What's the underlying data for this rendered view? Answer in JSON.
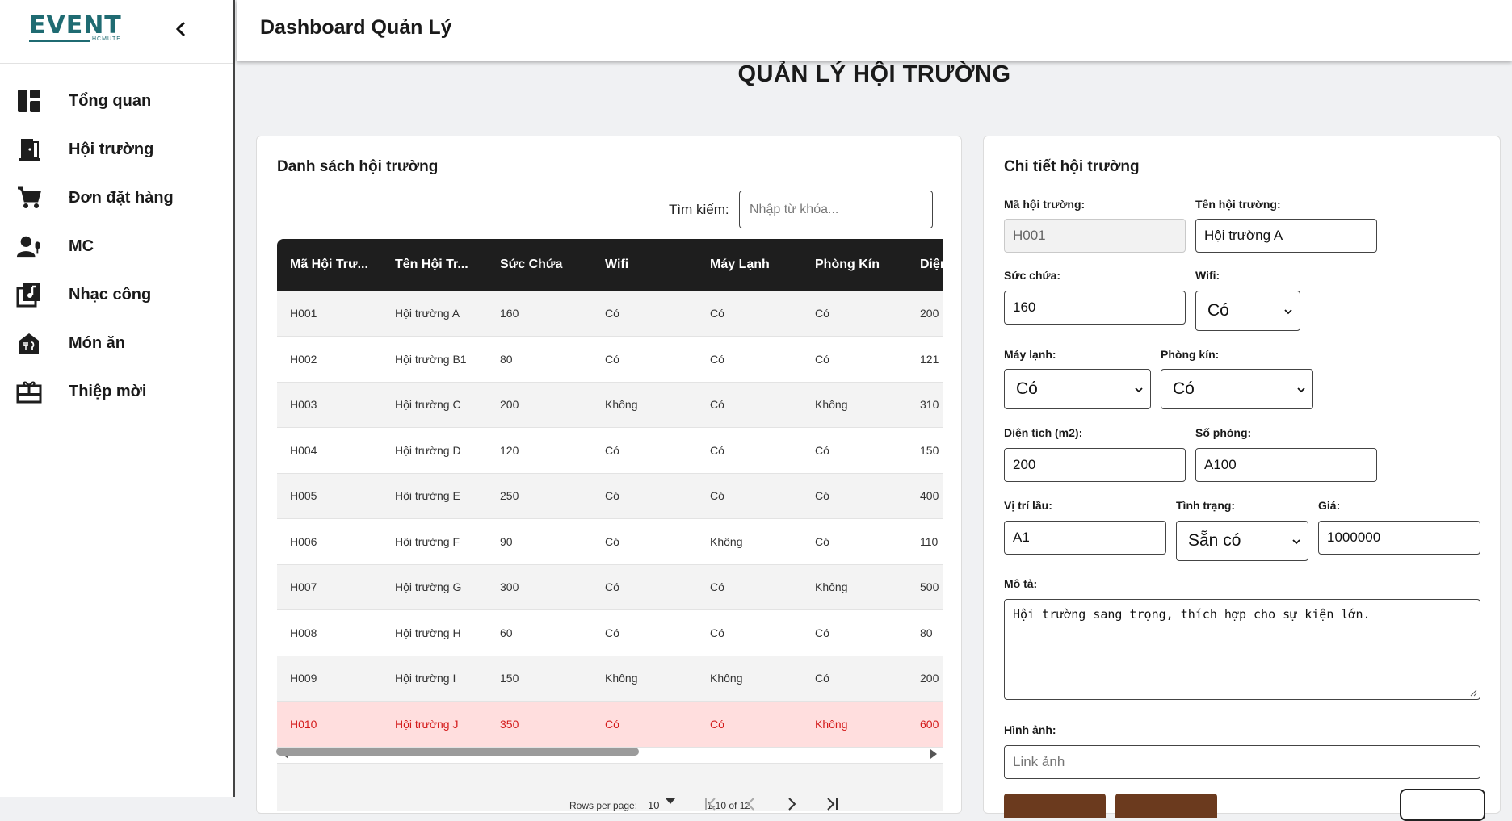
{
  "brand": {
    "logo_text": "EVENT",
    "logo_sub": "HCMUTE",
    "accent": "#1f6b72"
  },
  "sidebar": {
    "items": [
      {
        "label": "Tổng quan",
        "icon": "dashboard-icon"
      },
      {
        "label": "Hội trường",
        "icon": "door-icon"
      },
      {
        "label": "Đơn đặt hàng",
        "icon": "cart-icon"
      },
      {
        "label": "MC",
        "icon": "mic-person-icon"
      },
      {
        "label": "Nhạc công",
        "icon": "music-library-icon"
      },
      {
        "label": "Món ăn",
        "icon": "restaurant-icon"
      },
      {
        "label": "Thiệp mời",
        "icon": "gift-card-icon"
      }
    ]
  },
  "header": {
    "title": "Dashboard Quản Lý"
  },
  "page_title": "QUẢN LÝ HỘI TRƯỜNG",
  "list": {
    "title": "Danh sách hội trường",
    "search_label": "Tìm kiếm:",
    "search_placeholder": "Nhập từ khóa...",
    "columns": [
      "Mã Hội Trư...",
      "Tên Hội Tr...",
      "Sức Chứa",
      "Wifi",
      "Máy Lạnh",
      "Phòng Kín",
      "Diện"
    ],
    "rows": [
      [
        "H001",
        "Hội trường A",
        "160",
        "Có",
        "Có",
        "Có",
        "200"
      ],
      [
        "H002",
        "Hội trường B1",
        "80",
        "Có",
        "Có",
        "Có",
        "121"
      ],
      [
        "H003",
        "Hội trường C",
        "200",
        "Không",
        "Có",
        "Không",
        "310"
      ],
      [
        "H004",
        "Hội trường D",
        "120",
        "Có",
        "Có",
        "Có",
        "150"
      ],
      [
        "H005",
        "Hội trường E",
        "250",
        "Có",
        "Có",
        "Có",
        "400"
      ],
      [
        "H006",
        "Hội trường F",
        "90",
        "Có",
        "Không",
        "Có",
        "110"
      ],
      [
        "H007",
        "Hội trường G",
        "300",
        "Có",
        "Có",
        "Không",
        "500"
      ],
      [
        "H008",
        "Hội trường H",
        "60",
        "Có",
        "Có",
        "Có",
        "80"
      ],
      [
        "H009",
        "Hội trường I",
        "150",
        "Không",
        "Không",
        "Có",
        "200"
      ],
      [
        "H010",
        "Hội trường J",
        "350",
        "Có",
        "Có",
        "Không",
        "600"
      ]
    ],
    "selected_row_index": 9,
    "pagination": {
      "rows_per_page_label": "Rows per page:",
      "rows_per_page": "10",
      "range": "1-10 of 12"
    }
  },
  "detail": {
    "title": "Chi tiết hội trường",
    "code_label": "Mã hội trường:",
    "code_value": "H001",
    "name_label": "Tên hội trường:",
    "name_value": "Hội trường A",
    "capacity_label": "Sức chứa:",
    "capacity_value": "160",
    "wifi_label": "Wifi:",
    "wifi_value": "Có",
    "ac_label": "Máy lạnh:",
    "ac_value": "Có",
    "private_label": "Phòng kín:",
    "private_value": "Có",
    "area_label": "Diện tích (m2):",
    "area_value": "200",
    "room_label": "Số phòng:",
    "room_value": "A100",
    "floor_label": "Vị trí lầu:",
    "floor_value": "A1",
    "status_label": "Tình trạng:",
    "status_value": "Sẵn có",
    "price_label": "Giá:",
    "price_value": "1000000",
    "desc_label": "Mô tả:",
    "desc_value": "Hội trường sang trọng, thích hợp cho sự kiện lớn.",
    "image_label": "Hình ảnh:",
    "image_placeholder": "Link ảnh"
  }
}
